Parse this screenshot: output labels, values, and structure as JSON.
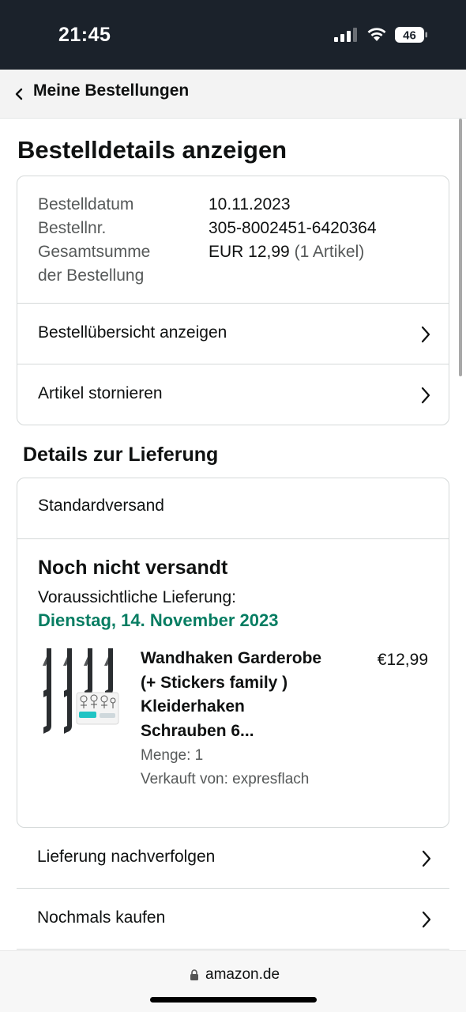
{
  "status_bar": {
    "time": "21:45",
    "battery": "46"
  },
  "nav": {
    "back_label": "Meine Bestellungen"
  },
  "page": {
    "title": "Bestelldetails anzeigen"
  },
  "summary": {
    "order_date_label": "Bestelldatum",
    "order_date": "10.11.2023",
    "order_number_label": "Bestellnr.",
    "order_number": "305-8002451-6420364",
    "total_label_line1": "Gesamtsumme",
    "total_label_line2": "der Bestellung",
    "total_value": "EUR 12,99",
    "total_items": "(1 Artikel)",
    "view_summary": "Bestellübersicht anzeigen",
    "cancel_items": "Artikel stornieren"
  },
  "delivery": {
    "section_title": "Details zur Lieferung",
    "shipping_method": "Standardversand",
    "status": "Noch nicht versandt",
    "expected_label": "Voraussichtliche Lieferung:",
    "expected_date": "Dienstag, 14. November 2023",
    "status_color": "#067d62",
    "product": {
      "title": "Wandhaken Garderobe (+ Stickers family ) Kleiderhaken Schrauben 6...",
      "price": "€12,99",
      "quantity": "Menge: 1",
      "seller": "Verkauft von: expresflach",
      "image": "black-wall-hooks-with-stickers"
    }
  },
  "actions": {
    "track": "Lieferung nachverfolgen",
    "buy_again": "Nochmals kaufen"
  },
  "browser": {
    "domain": "amazon.de"
  },
  "icons": {
    "back": "chevron-left-icon",
    "row": "chevron-right-icon",
    "lock": "lock-icon",
    "signal": "cellular-signal-icon",
    "wifi": "wifi-icon",
    "battery": "battery-icon"
  }
}
